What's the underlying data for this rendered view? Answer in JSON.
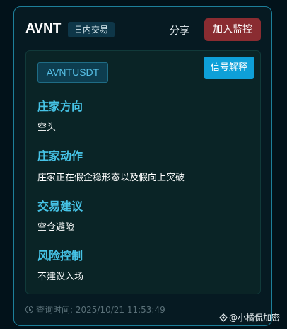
{
  "header": {
    "symbol": "AVNT",
    "badge": "日内交易",
    "share_label": "分享",
    "monitor_label": "加入监控"
  },
  "panel": {
    "pair": "AVNTUSDT",
    "explain_label": "信号解释",
    "sections": [
      {
        "title": "庄家方向",
        "body": "空头"
      },
      {
        "title": "庄家动作",
        "body": "庄家正在假企稳形态以及假向上突破"
      },
      {
        "title": "交易建议",
        "body": "空仓避险"
      },
      {
        "title": "风险控制",
        "body": "不建议入场"
      }
    ]
  },
  "footer": {
    "query_time": "查询时间: 2025/10/21 11:53:49"
  },
  "watermark": {
    "text": "@小橘侃加密"
  },
  "colors": {
    "accent": "#46c3e6",
    "monitor_button": "#8a2c31",
    "explain_button": "#0ea0d8",
    "card_border": "#1d7f9a"
  }
}
